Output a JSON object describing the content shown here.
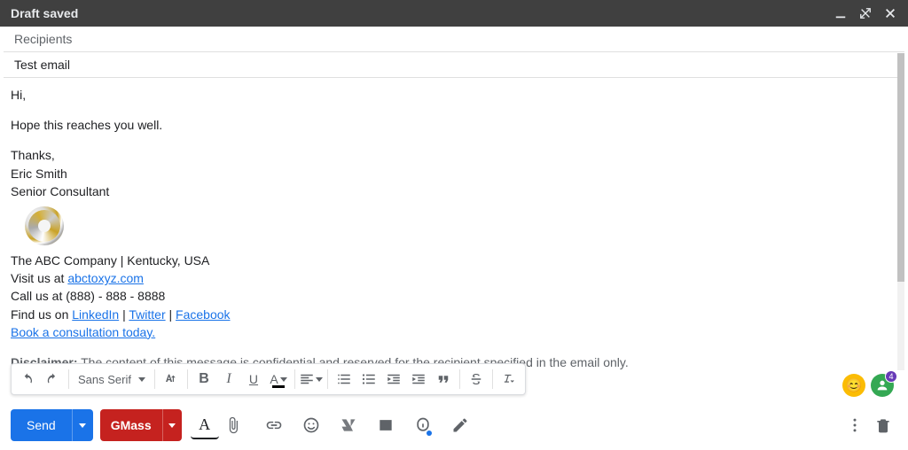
{
  "titlebar": {
    "title": "Draft saved"
  },
  "recipients": {
    "placeholder": "Recipients"
  },
  "subject": {
    "value": "Test email"
  },
  "body": {
    "greeting": "Hi,",
    "line1": "Hope this reaches you well.",
    "thanks": "Thanks,",
    "name": "Eric Smith",
    "role": "Senior Consultant",
    "company_line": "The ABC Company | Kentucky, USA",
    "visit_prefix": "Visit us at ",
    "visit_link": "abctoxyz.com",
    "call_line": "Call us at (888) - 888 - 8888",
    "find_prefix": "Find us on ",
    "linkedin": "LinkedIn",
    "sep1": " | ",
    "twitter": "Twitter",
    "sep2": " | ",
    "facebook": "Facebook",
    "book_link": "Book a consultation today.",
    "disclaimer_label": "Disclaimer:",
    "disclaimer_text": " The content of this message is confidential and reserved for the recipient specified in the email only."
  },
  "format_toolbar": {
    "font_family": "Sans Serif"
  },
  "actions": {
    "send": "Send",
    "gmass": "GMass"
  },
  "avatars": {
    "badge_count": "4"
  }
}
